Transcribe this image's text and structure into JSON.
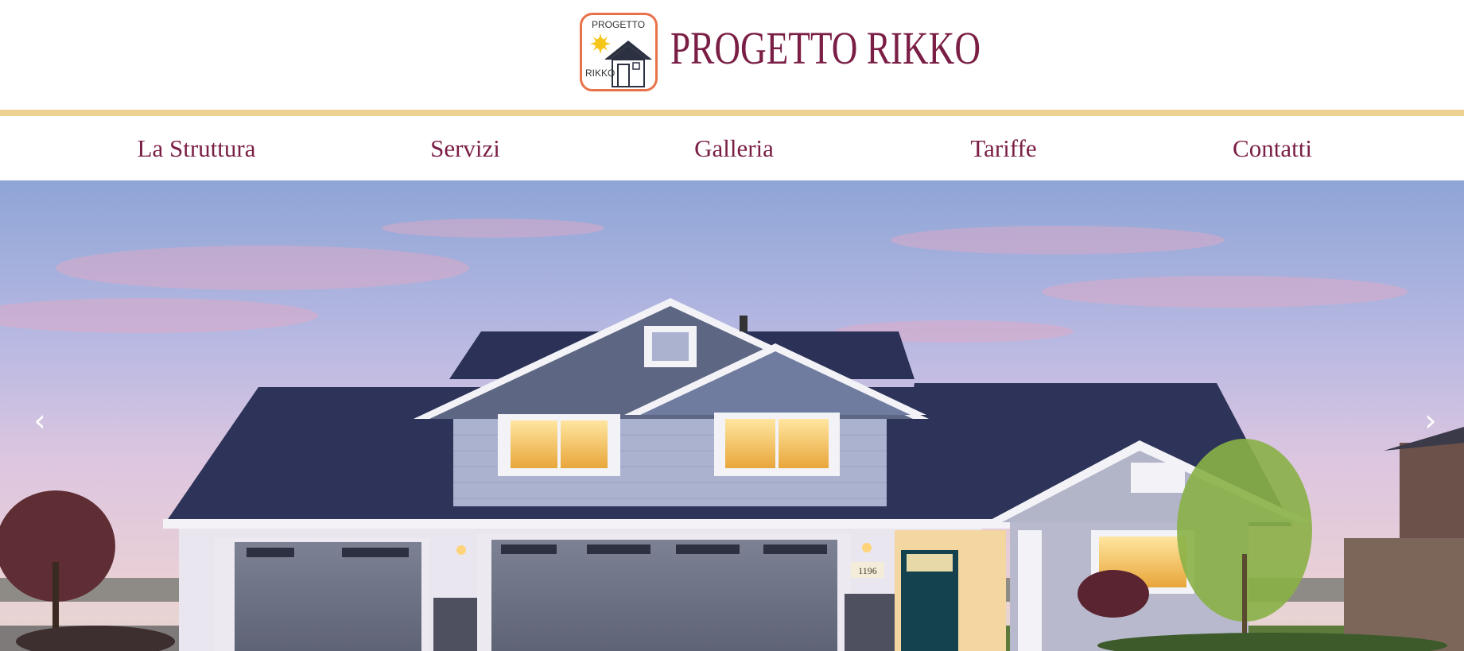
{
  "header": {
    "logo": {
      "top_text": "PROGETTO",
      "bottom_text": "RIKKO",
      "icon": "house-sun-logo"
    },
    "site_title": "PROGETTO RIKKO"
  },
  "nav": {
    "items": [
      {
        "label": "La Struttura"
      },
      {
        "label": "Servizi"
      },
      {
        "label": "Galleria"
      },
      {
        "label": "Tariffe"
      },
      {
        "label": "Contatti"
      }
    ]
  },
  "hero": {
    "prev_icon": "‹",
    "next_icon": "›",
    "house_number": "1196"
  },
  "colors": {
    "brand": "#7a1e45",
    "accent_line": "#ecd193",
    "logo_border": "#e8734a"
  }
}
